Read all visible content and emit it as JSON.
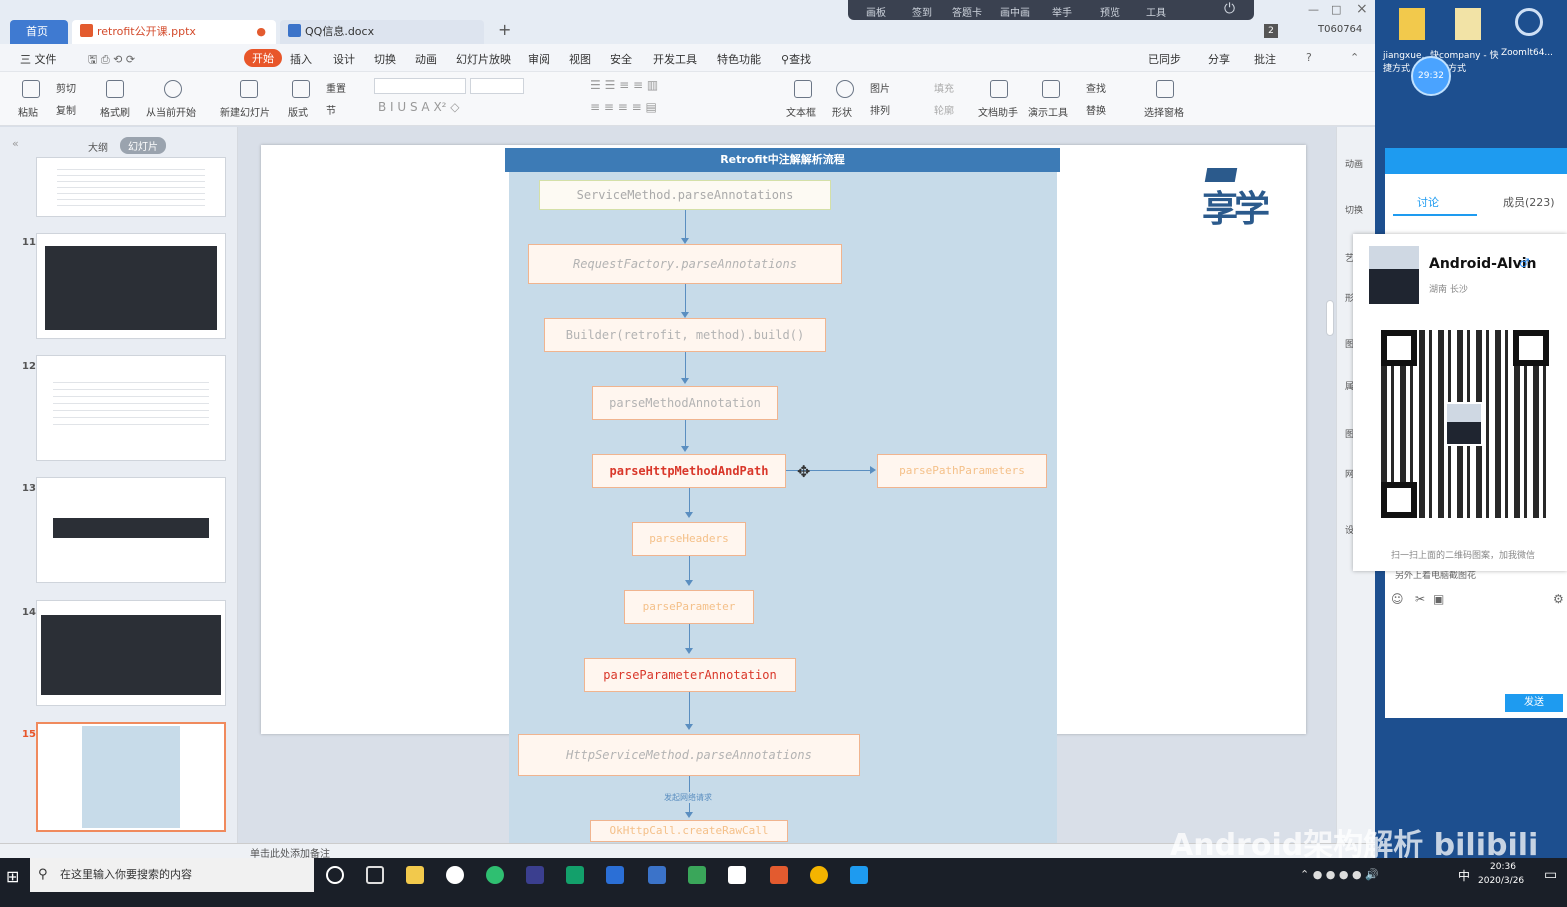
{
  "tabs": {
    "home": "首页",
    "pptx": "retrofit公开课.pptx",
    "docx": "QQ信息.docx",
    "new": "+"
  },
  "float_bar": {
    "items": [
      "画板",
      "签到",
      "答题卡",
      "画中画",
      "举手",
      "预览",
      "工具"
    ]
  },
  "top_right": {
    "badge": "2",
    "id": "T060764"
  },
  "menu": {
    "file": "三 文件",
    "items": [
      "开始",
      "插入",
      "设计",
      "切换",
      "动画",
      "幻灯片放映",
      "审阅",
      "视图",
      "安全",
      "开发工具",
      "特色功能",
      "查找"
    ],
    "right": [
      "已同步",
      "分享",
      "批注"
    ]
  },
  "ribbon": {
    "labels": [
      "粘贴",
      "剪切",
      "复制",
      "格式刷",
      "从当前开始",
      "新建幻灯片",
      "版式",
      "节",
      "重置",
      "文本框",
      "形状",
      "图片",
      "填充",
      "排列",
      "轮廓",
      "文档助手",
      "演示工具",
      "查找",
      "替换",
      "选择窗格"
    ]
  },
  "left_panel": {
    "tabs": [
      "大纲",
      "幻灯片"
    ],
    "numbers": [
      "11",
      "12",
      "13",
      "14",
      "15"
    ],
    "add": "+"
  },
  "status": {
    "note": "单击此处添加备注"
  },
  "flow": {
    "title": "Retrofit中注解解析流程",
    "boxes": [
      "ServiceMethod.parseAnnotations",
      "RequestFactory.parseAnnotations",
      "Builder(retrofit, method).build()",
      "parseMethodAnnotation",
      "parseHttpMethodAndPath",
      "parsePathParameters",
      "parseHeaders",
      "parseParameter",
      "parseParameterAnnotation",
      "HttpServiceMethod.parseAnnotations",
      "OkHttpCall.createRawCall"
    ],
    "edge_label": "发起网络请求"
  },
  "logo": {
    "text": "享学"
  },
  "right_col": [
    "动画",
    "切换",
    "艺术",
    "形",
    "图",
    "属",
    "图",
    "网",
    "设"
  ],
  "desktop": {
    "icons": [
      "jiangxue...快捷方式",
      "company - 快捷方式",
      "Zoomlt64..."
    ],
    "timer": "29:32"
  },
  "chat": {
    "tabs": [
      "讨论",
      "成员(223)"
    ],
    "send": "发送",
    "line": "另外上着电脑截图花"
  },
  "qr_card": {
    "name": "Android-Alvin",
    "location": "湖南 长沙",
    "hint": "扫一扫上面的二维码图案，加我微信"
  },
  "taskbar": {
    "search": "在这里输入你要搜索的内容",
    "time": "20:36",
    "date": "2020/3/26",
    "ime": "中"
  },
  "watermark": "Android架构解析 bilibili"
}
